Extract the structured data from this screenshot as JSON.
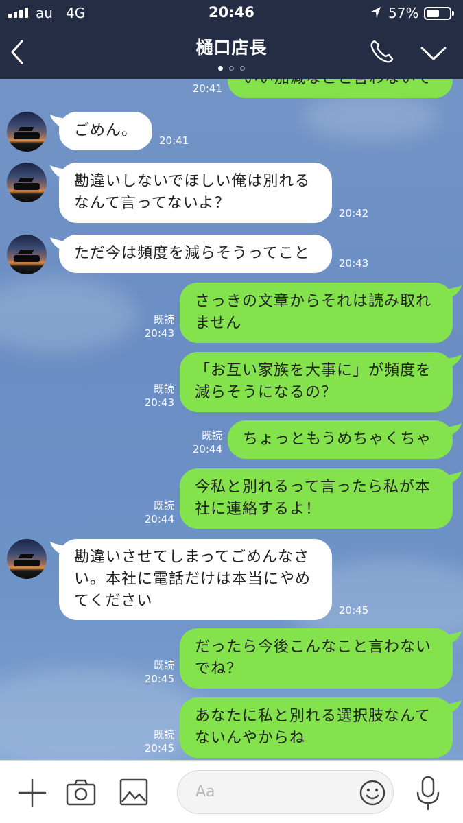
{
  "status_bar": {
    "carrier": "au",
    "network": "4G",
    "time": "20:46",
    "battery_percent": "57%",
    "battery_level": 0.57
  },
  "nav": {
    "title": "樋口店長",
    "page_count": 3,
    "active_page": 1
  },
  "messages": [
    {
      "from": "me",
      "lines": [
        "いい加減なこと言わないで"
      ],
      "read_label": "",
      "time": "20:41"
    },
    {
      "from": "them",
      "lines": [
        "ごめん。"
      ],
      "time": "20:41"
    },
    {
      "from": "them",
      "lines": [
        "勘違いしないでほしい俺は別れる",
        "なんて言ってないよ？"
      ],
      "time": "20:42"
    },
    {
      "from": "them",
      "lines": [
        "ただ今は頻度を減らそうってこと"
      ],
      "time": "20:43"
    },
    {
      "from": "me",
      "lines": [
        "さっきの文章からそれは読み取れ",
        "ません"
      ],
      "read_label": "既読",
      "time": "20:43"
    },
    {
      "from": "me",
      "lines": [
        "「お互い家族を大事に」が頻度を",
        "減らそうになるの？"
      ],
      "read_label": "既読",
      "time": "20:43"
    },
    {
      "from": "me",
      "lines": [
        "ちょっともうめちゃくちゃ"
      ],
      "read_label": "既読",
      "time": "20:44"
    },
    {
      "from": "me",
      "lines": [
        "今私と別れるって言ったら私が本",
        "社に連絡するよ！"
      ],
      "read_label": "既読",
      "time": "20:44"
    },
    {
      "from": "them",
      "lines": [
        "勘違いさせてしまってごめんなさ",
        "い。本社に電話だけは本当にやめ",
        "てください"
      ],
      "time": "20:45"
    },
    {
      "from": "me",
      "lines": [
        "だったら今後こんなこと言わない",
        "でね？"
      ],
      "read_label": "既読",
      "time": "20:45"
    },
    {
      "from": "me",
      "lines": [
        "あなたに私と別れる選択肢なんて",
        "ないんやからね"
      ],
      "read_label": "既読",
      "time": "20:45"
    }
  ],
  "input": {
    "placeholder": "Aa",
    "icons": [
      "plus-icon",
      "camera-icon",
      "image-icon",
      "emoji-icon",
      "microphone-icon"
    ]
  },
  "colors": {
    "header": "#252d45",
    "my_bubble": "#84e34c",
    "their_bubble": "#ffffff",
    "chat_background": "#6b8fc4"
  }
}
